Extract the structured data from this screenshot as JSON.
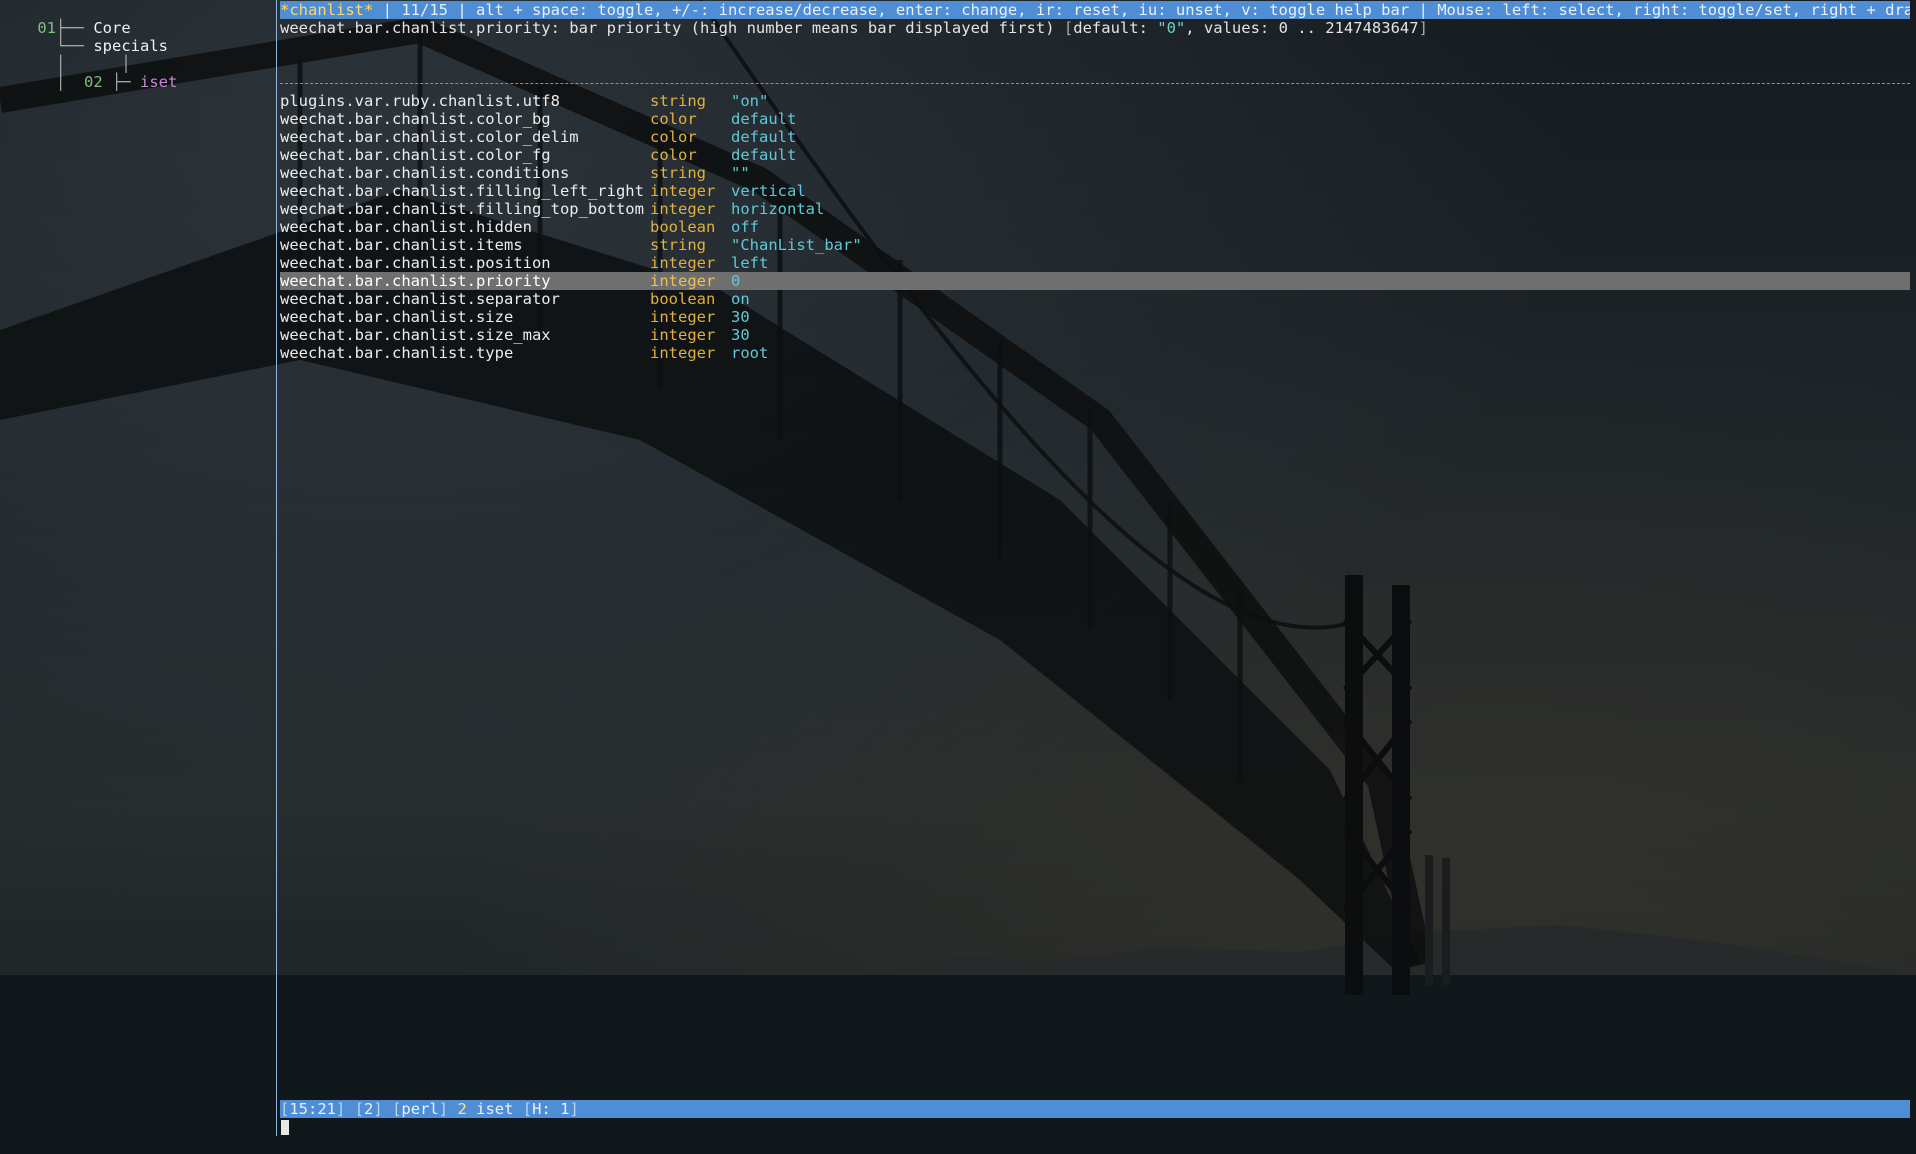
{
  "buflist": {
    "items": [
      {
        "number": "01",
        "name": "Core"
      },
      {
        "number": "",
        "name": "specials"
      },
      {
        "number": "02",
        "name": "iset"
      }
    ]
  },
  "titlebar": {
    "buffer": "*chanlist*",
    "position": "11/15",
    "help": "alt + space: toggle, +/-: increase/decrease, enter: change, ir: reset, iu: unset, v: toggle help bar",
    "mouse": "Mouse: left: select, right: toggle/set, right + drag le",
    "more": ">>"
  },
  "help": {
    "option": "weechat.bar.chanlist.priority",
    "description": "bar priority (high number means bar displayed first)",
    "default_label": "default:",
    "default_value": "\"0\"",
    "values_label": "values:",
    "values_range": "0 .. 2147483647"
  },
  "options": [
    {
      "name": "plugins.var.ruby.chanlist.utf8",
      "type": "string",
      "value": "\"on\""
    },
    {
      "name": "weechat.bar.chanlist.color_bg",
      "type": "color",
      "value": "default"
    },
    {
      "name": "weechat.bar.chanlist.color_delim",
      "type": "color",
      "value": "default"
    },
    {
      "name": "weechat.bar.chanlist.color_fg",
      "type": "color",
      "value": "default"
    },
    {
      "name": "weechat.bar.chanlist.conditions",
      "type": "string",
      "value": "\"\""
    },
    {
      "name": "weechat.bar.chanlist.filling_left_right",
      "type": "integer",
      "value": "vertical"
    },
    {
      "name": "weechat.bar.chanlist.filling_top_bottom",
      "type": "integer",
      "value": "horizontal"
    },
    {
      "name": "weechat.bar.chanlist.hidden",
      "type": "boolean",
      "value": "off"
    },
    {
      "name": "weechat.bar.chanlist.items",
      "type": "string",
      "value": "\"ChanList_bar\""
    },
    {
      "name": "weechat.bar.chanlist.position",
      "type": "integer",
      "value": "left"
    },
    {
      "name": "weechat.bar.chanlist.priority",
      "type": "integer",
      "value": "0",
      "selected": true
    },
    {
      "name": "weechat.bar.chanlist.separator",
      "type": "boolean",
      "value": "on"
    },
    {
      "name": "weechat.bar.chanlist.size",
      "type": "integer",
      "value": "30"
    },
    {
      "name": "weechat.bar.chanlist.size_max",
      "type": "integer",
      "value": "30"
    },
    {
      "name": "weechat.bar.chanlist.type",
      "type": "integer",
      "value": "root"
    }
  ],
  "statusbar": {
    "time": "15:21",
    "window": "2",
    "plugin": "perl",
    "buffer_number": "2",
    "buffer_name": "iset",
    "hotlist": "H: 1"
  },
  "colors": {
    "bar_bg": "#4f8ed4",
    "selected_bg": "#6f6f6f",
    "type_color": "#e0b040",
    "value_color": "#60c8d8"
  }
}
